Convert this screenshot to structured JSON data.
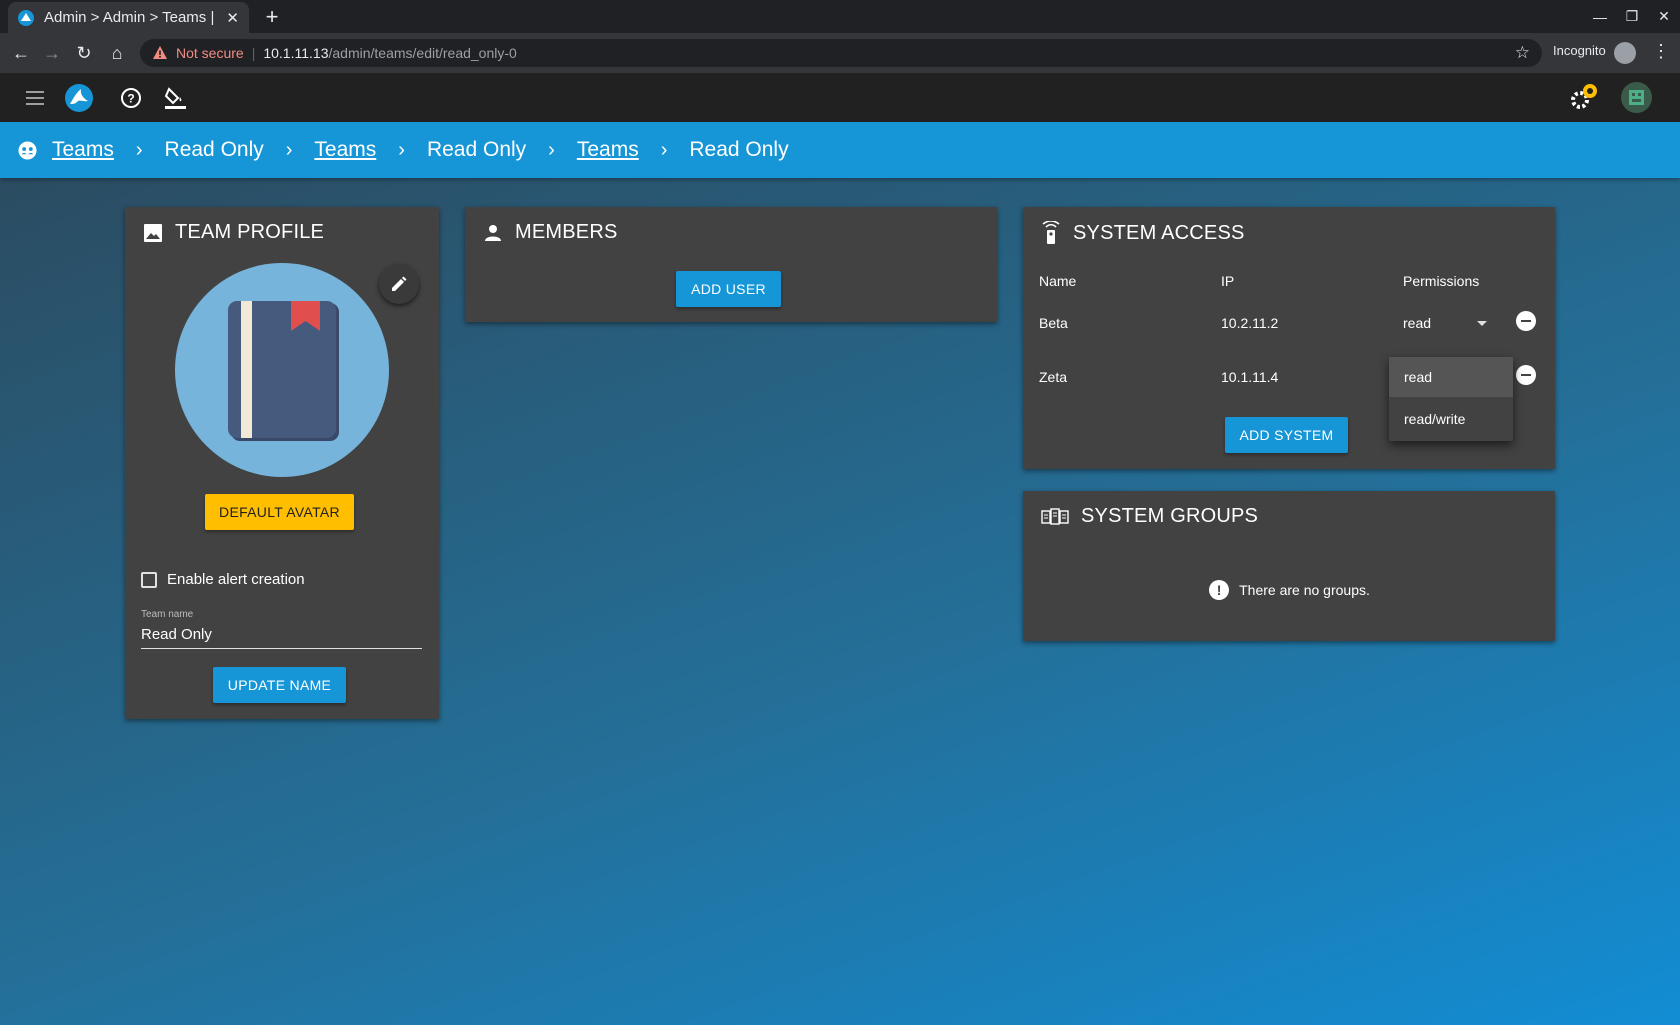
{
  "browser": {
    "tab_title": "Admin > Admin > Teams |",
    "new_tab_glyph": "+",
    "url_warning": "Not secure",
    "url_host": "10.1.11.13",
    "url_path": "/admin/teams/edit/read_only-0",
    "incognito_label": "Incognito"
  },
  "breadcrumb": {
    "items": [
      {
        "label": "Teams",
        "link": true
      },
      {
        "label": "Read Only",
        "link": false
      },
      {
        "label": "Teams",
        "link": true
      },
      {
        "label": "Read Only",
        "link": false
      },
      {
        "label": "Teams",
        "link": true
      },
      {
        "label": "Read Only",
        "link": false
      }
    ]
  },
  "team_profile": {
    "title": "TEAM PROFILE",
    "default_avatar_label": "DEFAULT AVATAR",
    "alert_checkbox_label": "Enable alert creation",
    "alert_checkbox_checked": false,
    "team_name_label": "Team name",
    "team_name_value": "Read Only",
    "update_name_label": "UPDATE NAME"
  },
  "members": {
    "title": "MEMBERS",
    "add_user_label": "ADD USER"
  },
  "system_access": {
    "title": "SYSTEM ACCESS",
    "columns": [
      "Name",
      "IP",
      "Permissions"
    ],
    "rows": [
      {
        "name": "Beta",
        "ip": "10.2.11.2",
        "permission": "read"
      },
      {
        "name": "Zeta",
        "ip": "10.1.11.4",
        "permission": "read"
      }
    ],
    "add_system_label": "ADD SYSTEM",
    "dropdown_options": [
      "read",
      "read/write"
    ],
    "dropdown_selected": "read"
  },
  "system_groups": {
    "title": "SYSTEM GROUPS",
    "empty_message": "There are no groups."
  },
  "colors": {
    "primary": "#1696d6",
    "accent_yellow": "#ffbe00",
    "card_bg": "#424242",
    "header_bg": "#212121"
  }
}
